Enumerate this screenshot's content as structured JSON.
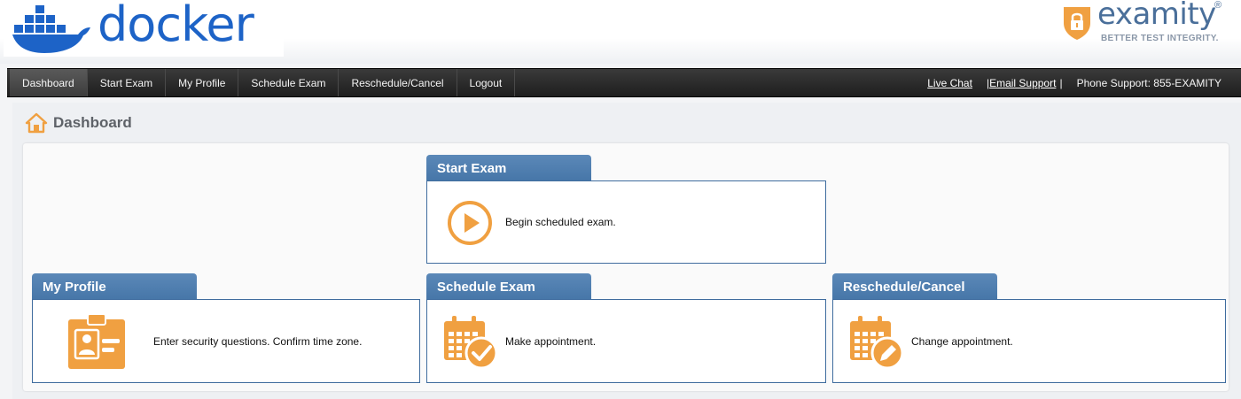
{
  "branding": {
    "left_logo_text": "docker",
    "right_logo_text": "examity",
    "right_logo_reg": "®",
    "right_logo_tagline": "BETTER TEST INTEGRITY."
  },
  "nav": {
    "items": [
      {
        "label": "Dashboard",
        "active": true
      },
      {
        "label": "Start Exam"
      },
      {
        "label": "My Profile"
      },
      {
        "label": "Schedule Exam"
      },
      {
        "label": "Reschedule/Cancel"
      },
      {
        "label": "Logout"
      }
    ],
    "live_chat": "Live Chat",
    "email_sep_left": "|",
    "email_support": "Email Support",
    "email_sep_right": "|",
    "phone_support": "Phone Support: 855-EXAMITY"
  },
  "page": {
    "title": "Dashboard"
  },
  "cards": {
    "start_exam": {
      "title": "Start Exam",
      "description": "Begin scheduled exam."
    },
    "my_profile": {
      "title": "My Profile",
      "description": "Enter security questions. Confirm time zone."
    },
    "schedule_exam": {
      "title": "Schedule Exam",
      "description": "Make appointment."
    },
    "reschedule_cancel": {
      "title": "Reschedule/Cancel",
      "description": "Change appointment."
    }
  },
  "colors": {
    "accent_orange": "#f0a041",
    "tab_blue": "#4676a8",
    "docker_blue": "#1d63c7"
  }
}
